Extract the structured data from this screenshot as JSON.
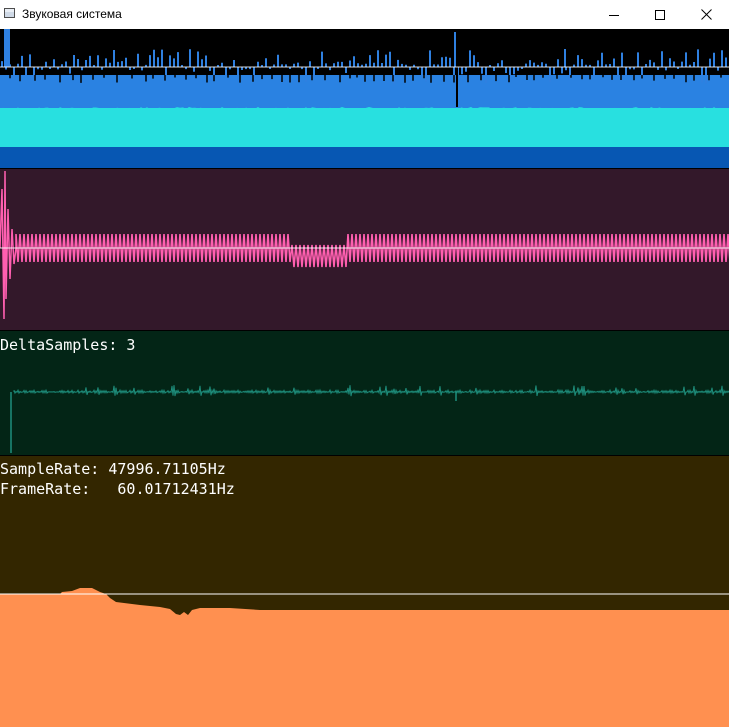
{
  "window": {
    "title": "Звуковая система",
    "icon": "app-window-icon",
    "controls": [
      "minimize-icon",
      "maximize-icon",
      "close-icon"
    ]
  },
  "panels": {
    "waveform": {
      "icon": "waveform-graph",
      "colors": {
        "background": "#000000",
        "bars": "#2f80e0",
        "band_mid": "#2a82e2",
        "band_cyan": "#28e0e0",
        "band_bottom": "#0757b3"
      }
    },
    "spectrum": {
      "icon": "oscillation-graph",
      "colors": {
        "background": "#33182a",
        "trace": "#ff5fb0",
        "baseline": "#ffffff"
      }
    },
    "delta": {
      "label": "DeltaSamples: 3",
      "colors": {
        "background": "#032516",
        "trace": "#1e8f7d"
      }
    },
    "rates": {
      "sample_rate_line": "SampleRate: 47996.71105Hz",
      "frame_rate_line": "FrameRate:   60.01712431Hz",
      "colors": {
        "background": "#332600",
        "fill": "#ff9050",
        "baseline": "#ffffff"
      }
    }
  }
}
